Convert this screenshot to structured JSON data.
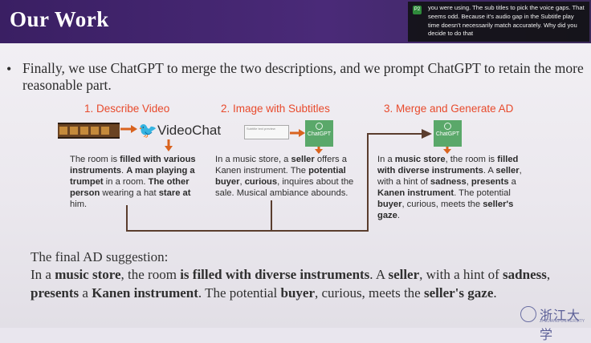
{
  "header": {
    "title": "Our Work"
  },
  "caption": {
    "icon_label": "P2",
    "text": "you were using. The sub titles to pick the voice gaps. That seems odd. Because it's audio gap in the Subtitle play time doesn't necessarily match accurately. Why did you decide to do that"
  },
  "bullet": {
    "marker": "•",
    "text": "Finally, we use ChatGPT to merge the two descriptions, and we prompt ChatGPT to retain the more reasonable part."
  },
  "steps": [
    {
      "title": "1. Describe Video"
    },
    {
      "title": "2. Image with Subtitles"
    },
    {
      "title": "3. Merge and  Generate AD"
    }
  ],
  "videochat_label": "VideoChat",
  "chatgpt_label": "ChatGPT",
  "subtitle_preview": "Subtitle text preview",
  "desc1": {
    "parts": [
      {
        "t": "The room is ",
        "b": false
      },
      {
        "t": "filled with various instruments",
        "b": true
      },
      {
        "t": ". ",
        "b": false
      },
      {
        "t": "A man playing a trumpet",
        "b": true
      },
      {
        "t": " in a room. ",
        "b": false
      },
      {
        "t": "The other person",
        "b": true
      },
      {
        "t": " wearing a hat ",
        "b": false
      },
      {
        "t": "stare at",
        "b": true
      },
      {
        "t": " him.",
        "b": false
      }
    ]
  },
  "desc2": {
    "parts": [
      {
        "t": "In a music store, a ",
        "b": false
      },
      {
        "t": "seller",
        "b": true
      },
      {
        "t": " offers a Kanen instrument. The ",
        "b": false
      },
      {
        "t": "potential buyer",
        "b": true
      },
      {
        "t": ", ",
        "b": false
      },
      {
        "t": "curious",
        "b": true
      },
      {
        "t": ", inquires about the sale. Musical ambiance abounds.",
        "b": false
      }
    ]
  },
  "desc3": {
    "parts": [
      {
        "t": "In a ",
        "b": false
      },
      {
        "t": "music store",
        "b": true
      },
      {
        "t": ", the room is ",
        "b": false
      },
      {
        "t": "filled with diverse instruments",
        "b": true
      },
      {
        "t": ". A ",
        "b": false
      },
      {
        "t": "seller",
        "b": true
      },
      {
        "t": ", with a hint of ",
        "b": false
      },
      {
        "t": "sadness",
        "b": true
      },
      {
        "t": ", ",
        "b": false
      },
      {
        "t": "presents",
        "b": true
      },
      {
        "t": " a ",
        "b": false
      },
      {
        "t": "Kanen",
        "b": true
      },
      {
        "t": " ",
        "b": false
      },
      {
        "t": "instrument",
        "b": true
      },
      {
        "t": ". The potential ",
        "b": false
      },
      {
        "t": "buyer",
        "b": true
      },
      {
        "t": ", curious, meets the ",
        "b": false
      },
      {
        "t": "seller's gaze",
        "b": true
      },
      {
        "t": ".",
        "b": false
      }
    ]
  },
  "final": {
    "label": "The final AD suggestion:",
    "parts": [
      {
        "t": "In a ",
        "b": false
      },
      {
        "t": "music store",
        "b": true
      },
      {
        "t": ", the room ",
        "b": false
      },
      {
        "t": "is filled with diverse instruments",
        "b": true
      },
      {
        "t": ". A ",
        "b": false
      },
      {
        "t": "seller",
        "b": true
      },
      {
        "t": ", with a hint of ",
        "b": false
      },
      {
        "t": "sadness",
        "b": true
      },
      {
        "t": ", ",
        "b": false
      },
      {
        "t": "presents",
        "b": true
      },
      {
        "t": " a ",
        "b": false
      },
      {
        "t": "Kanen instrument",
        "b": true
      },
      {
        "t": ". The potential ",
        "b": false
      },
      {
        "t": "buyer",
        "b": true
      },
      {
        "t": ", curious, meets the ",
        "b": false
      },
      {
        "t": "seller's gaze",
        "b": true
      },
      {
        "t": ".",
        "b": false
      }
    ]
  },
  "logo": {
    "text": "浙江大学",
    "sub": "ZHEJIANG UNIVERSITY"
  },
  "colors": {
    "header_bg": "#3a1f63",
    "step_title": "#e84a2c",
    "arrow": "#d9631f",
    "chatgpt_green": "#5aa86a"
  }
}
